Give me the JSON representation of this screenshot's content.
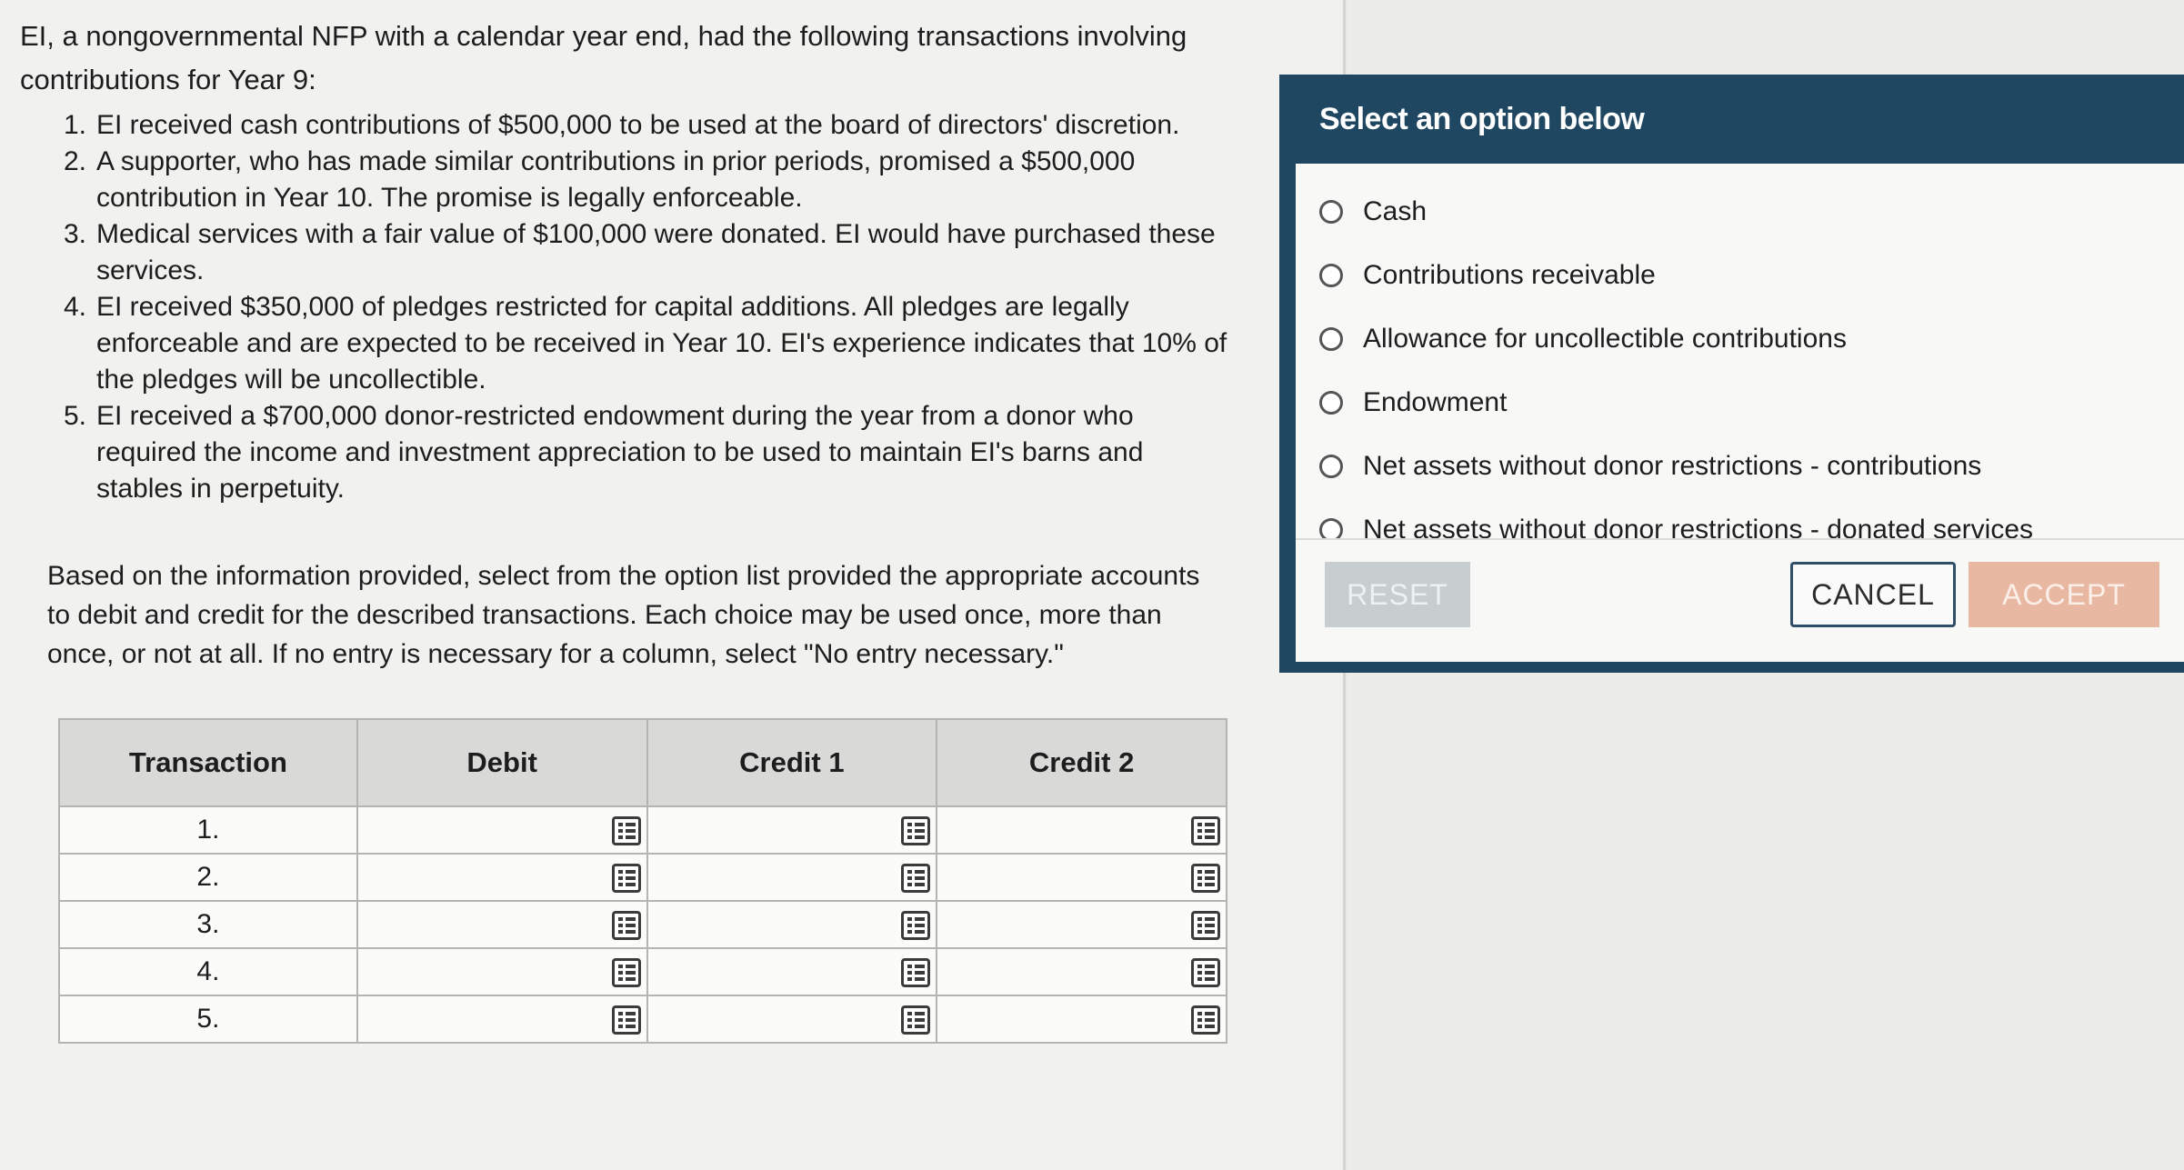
{
  "question": {
    "intro": "EI, a nongovernmental NFP with a calendar year end, had the following transactions involving contributions for Year 9:",
    "transactions": [
      {
        "num": "1.",
        "text": "EI received cash contributions of $500,000 to be used at the board of directors' discretion."
      },
      {
        "num": "2.",
        "text": "A supporter, who has made similar contributions in prior periods, promised a $500,000 contribution in Year 10. The promise is legally enforceable."
      },
      {
        "num": "3.",
        "text": "Medical services with a fair value of $100,000 were donated. EI would have purchased these services."
      },
      {
        "num": "4.",
        "text": "EI received $350,000 of pledges restricted for capital additions. All pledges are legally enforceable and are expected to be received in Year 10. EI's experience indicates that 10% of the pledges will be uncollectible."
      },
      {
        "num": "5.",
        "text": "EI received a $700,000 donor-restricted endowment during the year from a donor who required the income and investment appreciation to be used to maintain EI's barns and stables in perpetuity."
      }
    ],
    "instructions": "Based on the information provided, select from the option list provided the appropriate accounts to debit and credit for the described transactions. Each choice may be used once, more than once, or not at all. If no entry is necessary for a column, select \"No entry necessary.\""
  },
  "table": {
    "headers": [
      "Transaction",
      "Debit",
      "Credit 1",
      "Credit 2"
    ],
    "rows": [
      "1.",
      "2.",
      "3.",
      "4.",
      "5."
    ]
  },
  "dialog": {
    "title": "Select an option below",
    "options": [
      "Cash",
      "Contributions receivable",
      "Allowance for uncollectible contributions",
      "Endowment",
      "Net assets without donor restrictions - contributions",
      "Net assets without donor restrictions - donated services"
    ],
    "reset_label": "RESET",
    "cancel_label": "CANCEL",
    "accept_label": "ACCEPT"
  }
}
